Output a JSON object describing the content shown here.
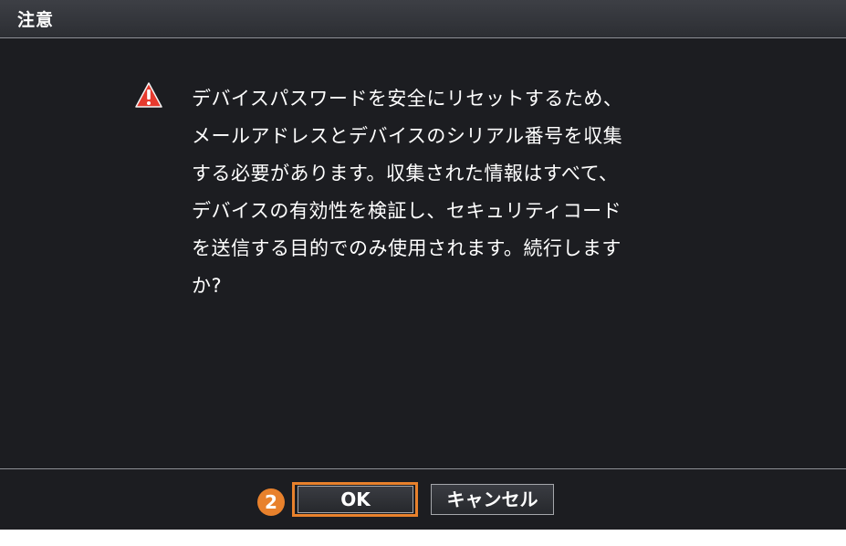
{
  "dialog": {
    "title": "注意",
    "icon": "warning-triangle-icon",
    "message": "デバイスパスワードを安全にリセットするため、\nメールアドレスとデバイスのシリアル番号を収集\nする必要があります。収集された情報はすべて、\nデバイスの有効性を検証し、セキュリティコード\nを送信する目的でのみ使用されます。続行します\nか?"
  },
  "footer": {
    "step_badge": "2",
    "ok_label": "OK",
    "cancel_label": "キャンセル"
  },
  "colors": {
    "background": "#1c1d21",
    "accent": "#e8812c",
    "warning": "#e63a2e"
  }
}
